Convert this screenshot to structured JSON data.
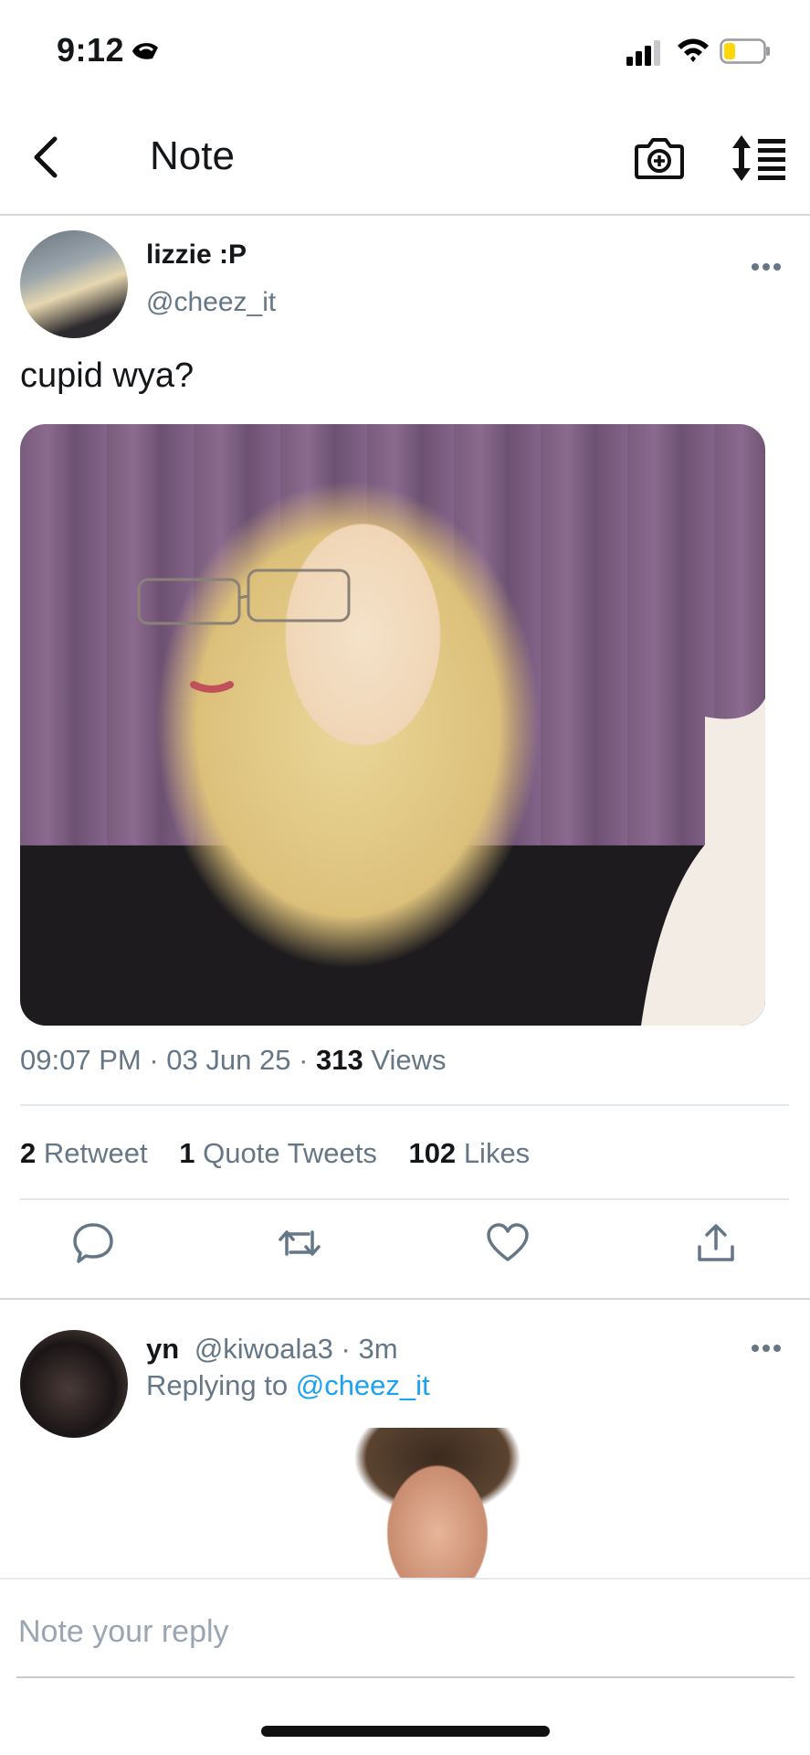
{
  "status_bar": {
    "time": "9:12",
    "focus_icon": "sleep-moon-icon",
    "battery_color": "#ffd60a"
  },
  "nav": {
    "title": "Note",
    "back_icon": "chevron-left-icon",
    "camera_icon": "camera-add-icon",
    "sort_icon": "sort-list-icon"
  },
  "tweet": {
    "author_name": "lizzie :P",
    "author_handle": "@cheez_it",
    "text": "cupid wya?",
    "time": "09:07 PM",
    "date": "03 Jun 25",
    "views_count": "313",
    "views_label": "Views",
    "stats": {
      "retweets_count": "2",
      "retweets_label": "Retweet",
      "quotes_count": "1",
      "quotes_label": "Quote Tweets",
      "likes_count": "102",
      "likes_label": "Likes"
    }
  },
  "actions": [
    "comment-icon",
    "retweet-icon",
    "heart-icon",
    "share-icon"
  ],
  "reply": {
    "name": "yn",
    "handle": "@kiwoala3",
    "time": "3m",
    "replying_prefix": "Replying to",
    "replying_handle": "@cheez_it"
  },
  "composer": {
    "placeholder": "Note your reply"
  },
  "colors": {
    "accent": "#1da1f2",
    "secondary_text": "#657786",
    "primary_text": "#14171a"
  }
}
